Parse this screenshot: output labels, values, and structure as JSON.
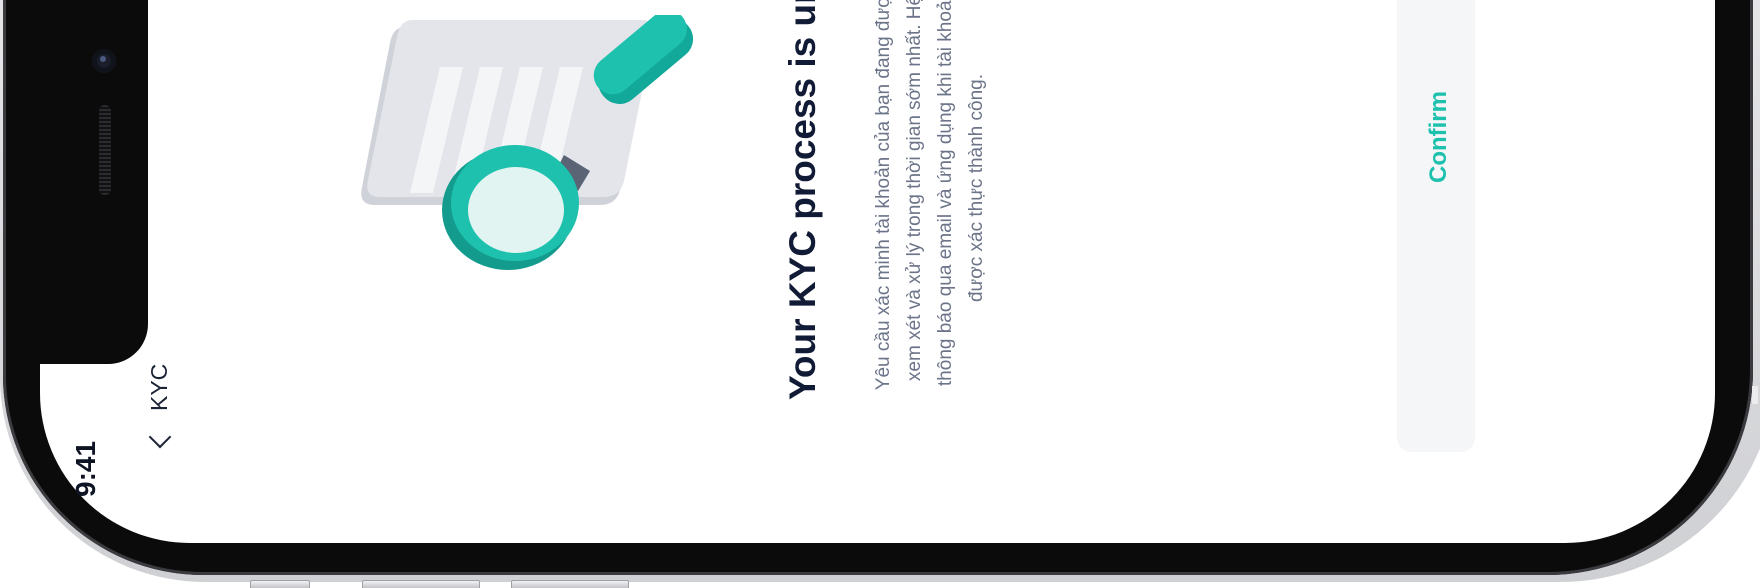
{
  "status_bar": {
    "time": "9:41"
  },
  "nav": {
    "title": "KYC",
    "back_icon": "chevron-left-icon"
  },
  "content": {
    "title": "Your KYC process is under",
    "description": "Yêu cầu xác minh tài khoản của bạn đang được xem xét và xử lý trong thời gian sớm nhất. Hệ thông báo qua email và ứng dụng khi tài khoản được xác thực thành công.",
    "illustration_icon": "document-magnifier-icon"
  },
  "actions": {
    "confirm_label": "Confirm"
  },
  "colors": {
    "accent": "#1ec1ad",
    "text_primary": "#111b36",
    "text_secondary": "#6c7489",
    "device": "#0b0b0c"
  }
}
